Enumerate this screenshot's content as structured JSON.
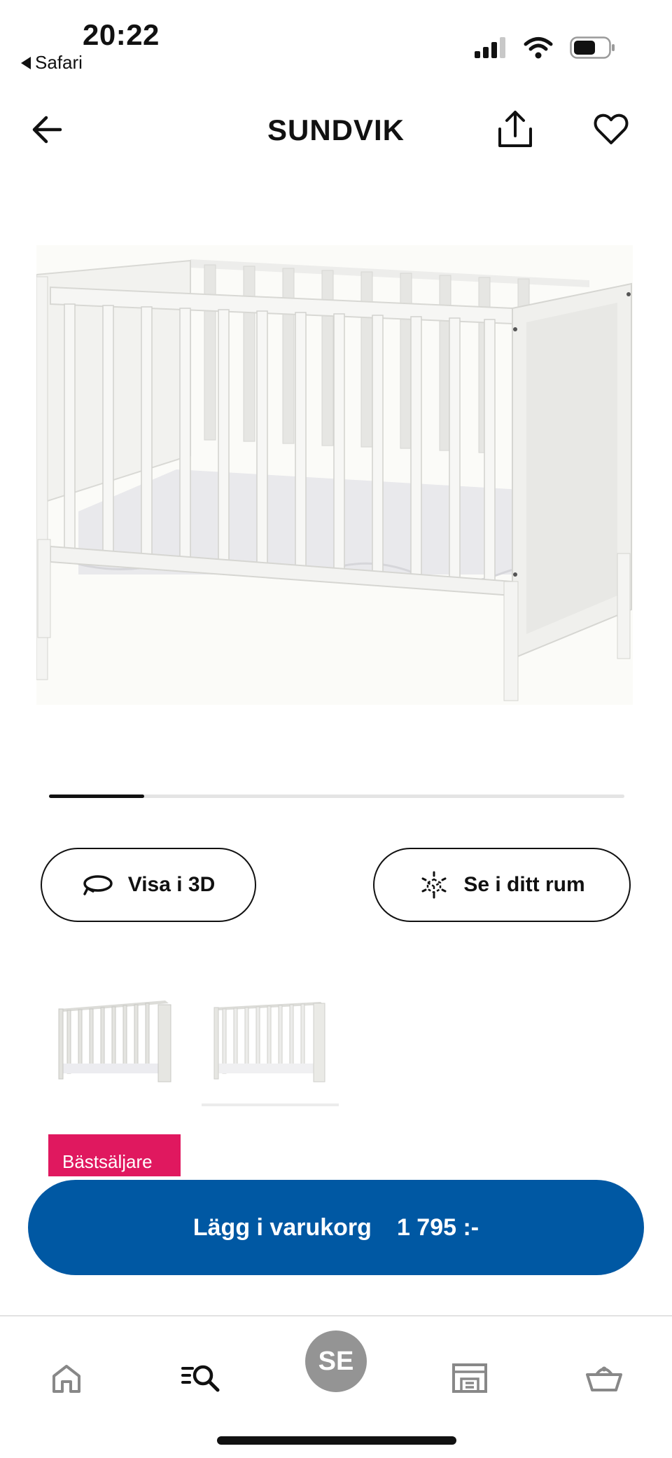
{
  "status_bar": {
    "time": "20:22",
    "back_app": "Safari"
  },
  "header": {
    "title": "SUNDVIK"
  },
  "gallery": {
    "progress": 0.165,
    "image_count": 2
  },
  "actions": {
    "view_3d_label": "Visa i 3D",
    "view_room_label": "Se i ditt rum"
  },
  "badge": {
    "label": "Bästsäljare",
    "color": "#e0185f"
  },
  "cart": {
    "label": "Lägg i varukorg",
    "price": "1 795 :-",
    "color": "#0058a3"
  },
  "bottom_nav": {
    "items": [
      "home-icon",
      "search-icon",
      "country-selector",
      "store-icon",
      "basket-icon"
    ],
    "country_label": "SE"
  }
}
